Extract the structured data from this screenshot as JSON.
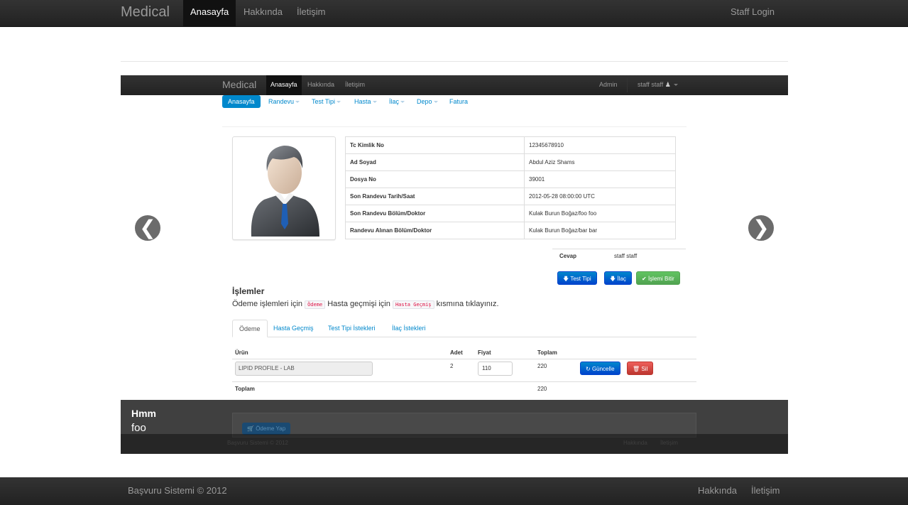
{
  "outer_nav": {
    "brand": "Medical",
    "links": [
      "Anasayfa",
      "Hakkında",
      "İletişim"
    ],
    "login": "Staff Login"
  },
  "inner_nav": {
    "brand": "Medical",
    "links": [
      "Anasayfa",
      "Hakkında",
      "İletişim"
    ],
    "admin": "Admin",
    "user": "staff staff"
  },
  "subnav": [
    "Anasayfa",
    "Randevu",
    "Test Tipi",
    "Hasta",
    "İlaç",
    "Depo",
    "Fatura"
  ],
  "patient": {
    "rows": [
      {
        "label": "Tc Kimlik No",
        "value": "12345678910"
      },
      {
        "label": "Ad Soyad",
        "value": "Abdul Aziz Shams"
      },
      {
        "label": "Dosya No",
        "value": "39001"
      },
      {
        "label": "Son Randevu Tarih/Saat",
        "value": "2012-05-28 08:00:00 UTC"
      },
      {
        "label": "Son Randevu Bölüm/Doktor",
        "value": "Kulak Burun Boğaz/foo foo"
      },
      {
        "label": "Randevu Alınan Bölüm/Doktor",
        "value": "Kulak Burun Boğaz/bar bar"
      }
    ]
  },
  "cevap": {
    "label": "Cevap",
    "value": "staff staff"
  },
  "actions": {
    "test_tipi": "Test Tipi",
    "ilac": "İlaç",
    "bitir": "İşlemi Bitir"
  },
  "islemler": {
    "title": "İşlemler",
    "t1": "Ödeme işlemleri için",
    "code1": "Ödeme",
    "t2": "Hasta geçmişi için",
    "code2": "Hasta Geçmiş",
    "t3": "kısmına tıklayınız."
  },
  "tabs": [
    "Ödeme",
    "Hasta Geçmiş",
    "Test Tipi İstekleri",
    "İlaç İstekleri"
  ],
  "table": {
    "headers": {
      "urun": "Ürün",
      "adet": "Adet",
      "fiyat": "Fiyat",
      "toplam": "Toplam"
    },
    "row": {
      "urun": "LIPID PROFILE - LAB",
      "adet": "2",
      "fiyat": "110",
      "toplam": "220"
    },
    "guncelle": "Güncelle",
    "sil": "Sil",
    "total_label": "Toplam",
    "total_value": "220"
  },
  "caption": {
    "title": "Hmm",
    "text": "foo"
  },
  "pay_button": "Ödeme Yap",
  "inner_footer": {
    "copy": "Başvuru Sistemi © 2012",
    "links": [
      "Hakkında",
      "İletişim"
    ]
  },
  "outer_footer": {
    "copy": "Başvuru Sistemi © 2012",
    "links": [
      "Hakkında",
      "İletişim"
    ]
  },
  "carousel": {
    "prev": "❮",
    "next": "❯"
  }
}
